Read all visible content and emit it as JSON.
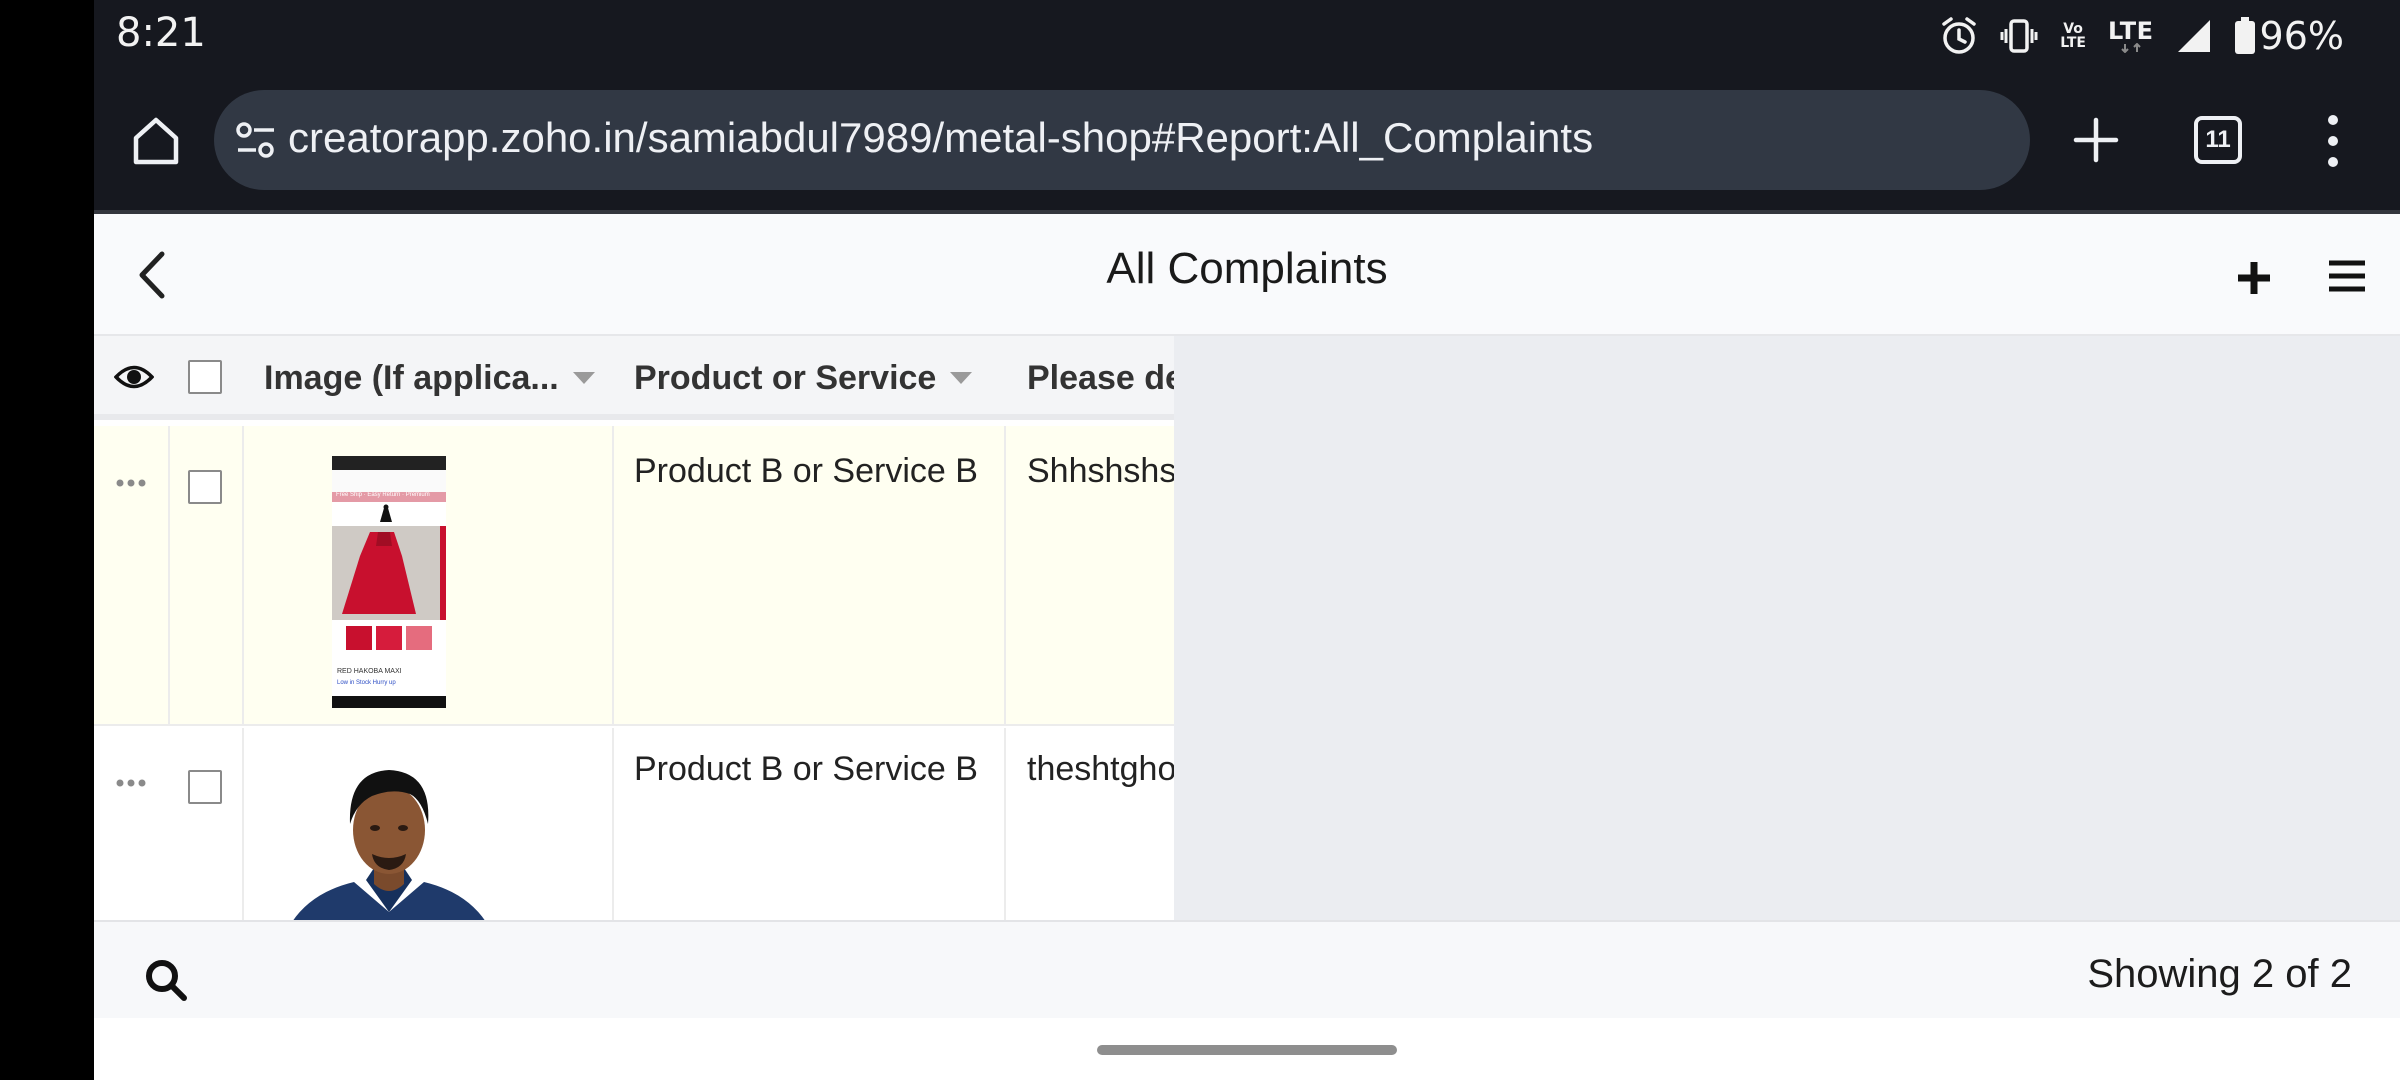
{
  "status_bar": {
    "time": "8:21",
    "volte_top": "Vo",
    "volte_bottom": "LTE",
    "network": "LTE",
    "battery": "96%",
    "icons": [
      "alarm-icon",
      "vibrate-icon",
      "volte-icon",
      "lte-icon",
      "signal-icon",
      "battery-icon"
    ]
  },
  "browser": {
    "url": "creatorapp.zoho.in/samiabdul7989/metal-shop#Report:All_Complaints",
    "tab_count": "11",
    "icons": [
      "home-icon",
      "site-settings-icon",
      "new-tab-icon",
      "tabs-icon",
      "more-icon"
    ]
  },
  "app_header": {
    "title": "All Complaints"
  },
  "table": {
    "columns": [
      {
        "label": "Image (If applica...",
        "sortable": true
      },
      {
        "label": "Product or Service",
        "sortable": true
      },
      {
        "label": "Please de",
        "sortable": false
      }
    ],
    "rows": [
      {
        "product": "Product B or Service B",
        "description": "Shhshshs",
        "image": "screenshot-thumbnail"
      },
      {
        "product": "Product B or Service B",
        "description": "theshtgho",
        "image": "person-photo"
      }
    ]
  },
  "thumbnail": {
    "banner_text": "Free Ship · Easy Return · Premium",
    "product_label": "RED HAKOBA MAXI",
    "stock_text": "Low in Stock Hurry up"
  },
  "footer": {
    "showing": "Showing 2 of 2"
  },
  "colors": {
    "browser_bg": "#16181f",
    "omnibox_bg": "#313844",
    "row_highlight": "#fffff1",
    "panel_bg": "#ebedf1"
  }
}
